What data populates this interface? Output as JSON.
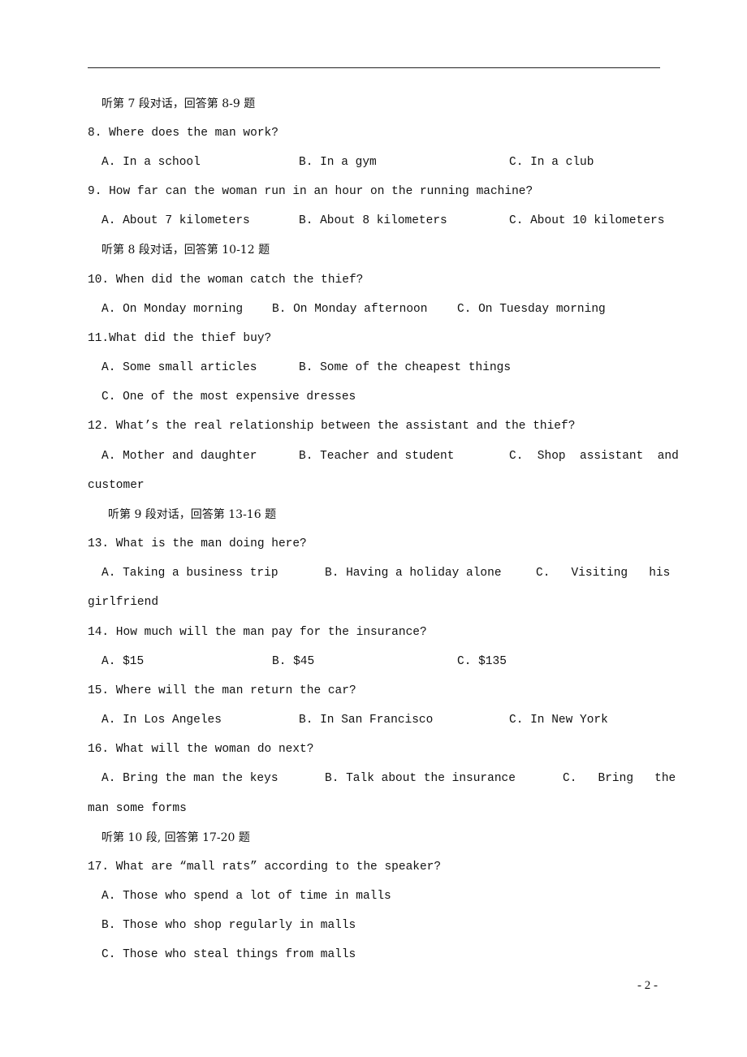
{
  "page_number": "- 2 -",
  "sections": [
    {
      "heading": "听第 7 段对话，回答第 8-9 题",
      "questions": [
        {
          "stem": "8. Where does the man work?",
          "options": [
            "A. In a school",
            "B. In a gym",
            "C. In a club"
          ]
        },
        {
          "stem": "9. How far can the woman run in an hour on the running machine?",
          "options": [
            "A. About 7 kilometers",
            "B. About 8 kilometers",
            "C. About 10 kilometers"
          ]
        }
      ]
    },
    {
      "heading": "听第 8 段对话，回答第 10-12 题",
      "questions": [
        {
          "stem": "10. When did the woman catch the thief?",
          "options": [
            "A. On Monday morning",
            "B. On Monday afternoon",
            "C. On Tuesday morning"
          ]
        },
        {
          "stem": "11.What did the thief buy?",
          "options": [
            "A. Some small articles",
            "B. Some of the cheapest things",
            "C. One of the most expensive dresses"
          ]
        },
        {
          "stem": "12. What’s the real relationship between the assistant and the thief?",
          "options": [
            "A. Mother and daughter",
            "B. Teacher and student",
            "C. Shop assistant and customer"
          ]
        }
      ]
    },
    {
      "heading": "听第 9 段对话，回答第 13-16 题",
      "questions": [
        {
          "stem": "13. What is the man doing here?",
          "options": [
            "A. Taking a business trip",
            "B. Having a holiday alone",
            "C. Visiting his girlfriend"
          ]
        },
        {
          "stem": "14. How much will the man pay for the insurance?",
          "options": [
            "A. $15",
            "B. $45",
            "C. $135"
          ]
        },
        {
          "stem": "15. Where will the man return the car?",
          "options": [
            "A. In Los Angeles",
            "B. In San Francisco",
            "C. In New York"
          ]
        },
        {
          "stem": "16. What will the woman do next?",
          "options": [
            "A. Bring the man the keys",
            "B. Talk about the insurance",
            "C. Bring the man some forms"
          ]
        }
      ]
    },
    {
      "heading": "听第 10 段, 回答第 17-20 题",
      "questions": [
        {
          "stem": "17. What are “mall rats” according to the speaker?",
          "options": [
            "A. Those who spend a lot of time in malls",
            "B. Those who shop regularly in malls",
            "C. Those who steal things from malls"
          ]
        }
      ]
    }
  ],
  "wrap": {
    "q12_c_line1": "C.  Shop  assistant  and",
    "q12_c_line2": "customer",
    "q13_c_line1": "C.   Visiting   his",
    "q13_c_line2": "girlfriend",
    "q16_c_line1": "C.   Bring   the",
    "q16_c_line2": "man some forms"
  }
}
